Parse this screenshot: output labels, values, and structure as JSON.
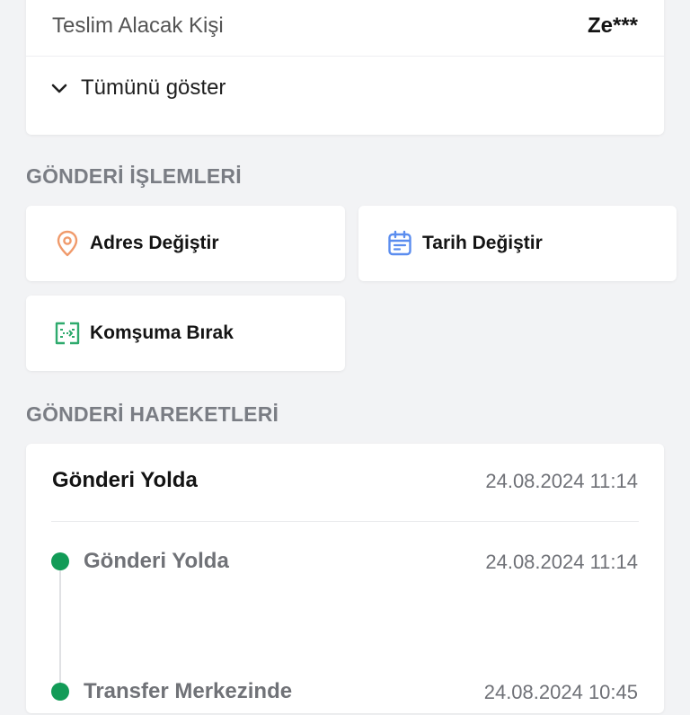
{
  "recipient": {
    "label": "Teslim Alacak Kişi",
    "value": "Ze***"
  },
  "show_all": {
    "label": "Tümünü göster",
    "icon": "chevron-down-icon"
  },
  "actions_section": {
    "title": "GÖNDERİ İŞLEMLERİ",
    "items": [
      {
        "label": "Adres Değiştir",
        "icon": "location-pin-icon",
        "color": "#f09a6b"
      },
      {
        "label": "Tarih Değiştir",
        "icon": "calendar-icon",
        "color": "#5b8def"
      },
      {
        "label": "Komşuma Bırak",
        "icon": "transfer-icon",
        "color": "#2eaa6d"
      }
    ]
  },
  "movements_section": {
    "title": "GÖNDERİ HAREKETLERİ",
    "current": {
      "status": "Gönderi Yolda",
      "datetime": "24.08.2024 11:14"
    },
    "timeline": [
      {
        "status": "Gönderi Yolda",
        "datetime": "24.08.2024 11:14"
      },
      {
        "status": "Transfer Merkezinde",
        "datetime": "24.08.2024 10:45"
      }
    ],
    "dot_color": "#129b57"
  }
}
